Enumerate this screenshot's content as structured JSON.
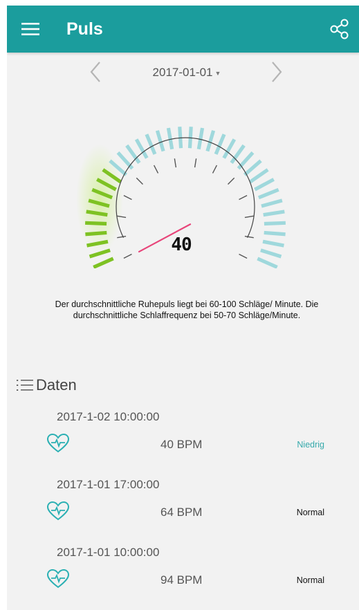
{
  "app_bar": {
    "title": "Puls",
    "menu_icon": "hamburger-menu-icon",
    "share_icon": "share-icon",
    "color": "#1b9d9d"
  },
  "date_nav": {
    "selected_date": "2017-01-01",
    "prev_icon": "chevron-left-icon",
    "next_icon": "chevron-right-icon"
  },
  "gauge": {
    "reading": "40",
    "value": 40,
    "needle_color": "#e8457a",
    "low_zone_color": "#7ec223",
    "normal_zone_color": "#9fd8dc"
  },
  "info": {
    "text": "Der durchschnittliche Ruhepuls liegt bei 60-100 Schläge/ Minute. Die durchschnittliche Schlaffrequenz bei 50-70 Schläge/Minute."
  },
  "section": {
    "title": "Daten",
    "icon": "list-icon"
  },
  "records": [
    {
      "time": "2017-1-02 10:00:00",
      "bpm": "40 BPM",
      "status": "Niedrig",
      "status_color": "#35a9ab"
    },
    {
      "time": "2017-1-01 17:00:00",
      "bpm": "64 BPM",
      "status": "Normal",
      "status_color": "#111111"
    },
    {
      "time": "2017-1-01 10:00:00",
      "bpm": "94 BPM",
      "status": "Normal",
      "status_color": "#111111"
    }
  ]
}
